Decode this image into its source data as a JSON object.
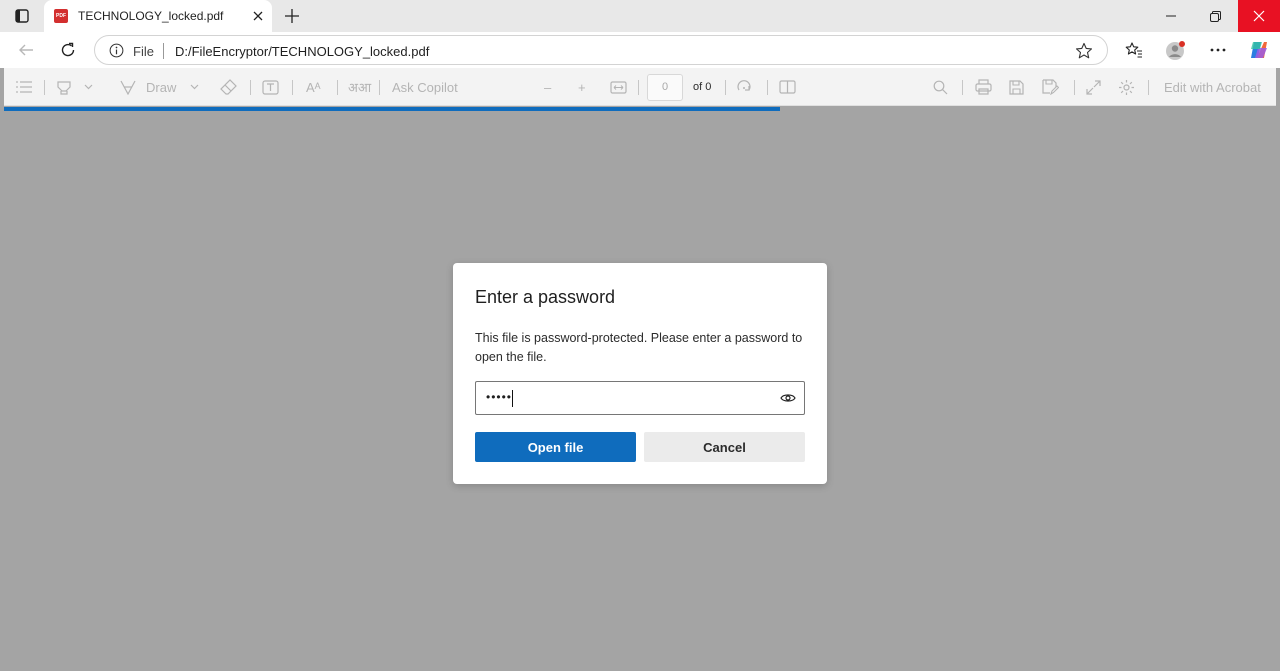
{
  "tab": {
    "title": "TECHNOLOGY_locked.pdf",
    "favicon": "pdf-icon",
    "favicon_text": "PDF"
  },
  "address_bar": {
    "scheme_label": "File",
    "url": "D:/FileEncryptor/TECHNOLOGY_locked.pdf"
  },
  "pdf_toolbar": {
    "draw_label": "Draw",
    "read_aloud_glyph": "Aᴬ",
    "translate_glyph": "अआ",
    "ask_copilot_label": "Ask Copilot",
    "zoom_out_glyph": "–",
    "zoom_in_glyph": "+",
    "page_number": "0",
    "page_of": "of 0",
    "edit_label": "Edit with Acrobat"
  },
  "loading_progress": 0.61,
  "dialog": {
    "title": "Enter a password",
    "message": "This file is password-protected. Please enter a password to open the file.",
    "password_value": "•••••",
    "open_button": "Open file",
    "cancel_button": "Cancel"
  },
  "colors": {
    "accent": "#0f6cbd",
    "close_window": "#e81123",
    "backdrop": "#a4a4a4"
  }
}
